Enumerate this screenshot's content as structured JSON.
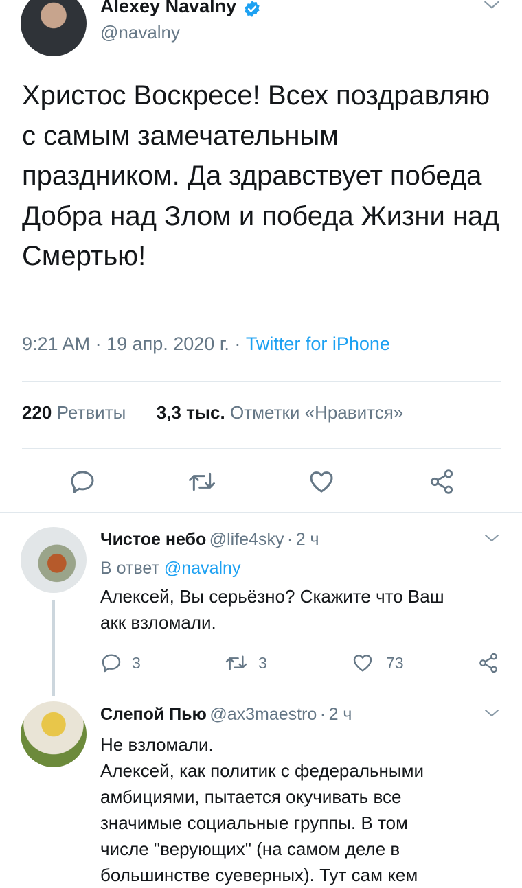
{
  "tweet": {
    "author": "Alexey Navalny",
    "handle": "@navalny",
    "text": "Христос Воскресе! Всех поздравляю с самым замечательным праздником. Да здравствует победа Добра над Злом и победа Жизни над Смертью!",
    "time": "9:21 AM",
    "sep1": " · ",
    "date": "19 апр. 2020 г.",
    "sep2": " · ",
    "source": "Twitter for iPhone",
    "retweets_count": "220",
    "retweets_label": "Ретвиты",
    "likes_count": "3,3 тыс.",
    "likes_label": "Отметки «Нравится»"
  },
  "replies": [
    {
      "name": "Чистое небо",
      "handle": "@life4sky",
      "dot": "·",
      "time": "2 ч",
      "reply_to_label": "В ответ",
      "reply_to_handle": "@navalny",
      "text_line1": "Алексей, Вы серьёзно? Скажите что Ваш",
      "text_line2": "акк взломали.",
      "reply_count": "3",
      "retweet_count": "3",
      "like_count": "73"
    },
    {
      "name": "Слепой Пью",
      "handle": "@ax3maestro",
      "dot": "·",
      "time": "2 ч",
      "lines": [
        "Не взломали.",
        "Алексей, как политик с федеральными",
        "амбициями, пытается окучивать все",
        "значимые социальные группы. В том",
        "числе \"верующих\" (на самом деле в",
        "большинстве суеверных). Тут сам кем"
      ]
    }
  ],
  "colors": {
    "accent": "#1da1f2",
    "muted": "#657786",
    "divider": "#e1e8ed",
    "text": "#14171a"
  }
}
